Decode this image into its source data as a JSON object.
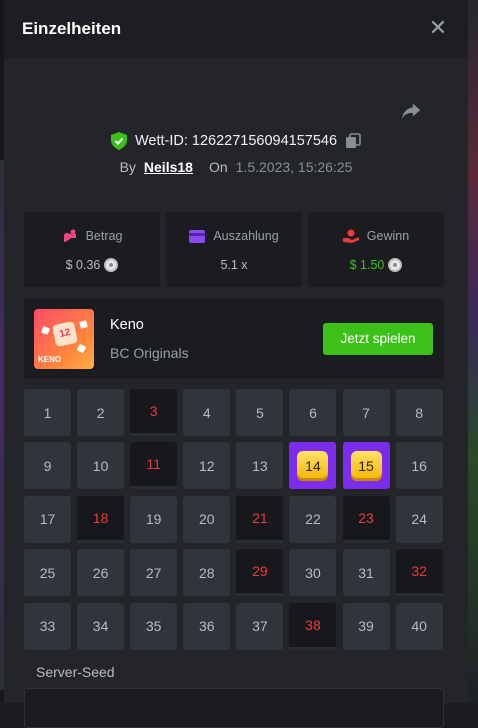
{
  "modal": {
    "title": "Einzelheiten"
  },
  "bet": {
    "id_label": "Wett-ID:",
    "id_value": "126227156094157546",
    "by_label": "By",
    "username": "Neils18",
    "on_label": "On",
    "date": "1.5.2023, 15:26:25"
  },
  "stats": {
    "amount": {
      "label": "Betrag",
      "value": "$ 0.36"
    },
    "payout": {
      "label": "Auszahlung",
      "value": "5.1 x"
    },
    "profit": {
      "label": "Gewinn",
      "value": "$ 1.50"
    }
  },
  "game": {
    "name": "Keno",
    "provider": "BC Originals",
    "play_label": "Jetzt spielen",
    "thumb_label": "KENO",
    "thumb_ball": "12"
  },
  "grid": {
    "numbers": [
      "1",
      "2",
      "3",
      "4",
      "5",
      "6",
      "7",
      "8",
      "9",
      "10",
      "11",
      "12",
      "13",
      "14",
      "15",
      "16",
      "17",
      "18",
      "19",
      "20",
      "21",
      "22",
      "23",
      "24",
      "25",
      "26",
      "27",
      "28",
      "29",
      "30",
      "31",
      "32",
      "33",
      "34",
      "35",
      "36",
      "37",
      "38",
      "39",
      "40"
    ],
    "drawn": [
      3,
      11,
      18,
      21,
      23,
      29,
      32,
      38
    ],
    "hits": [
      14,
      15
    ]
  },
  "server_seed": {
    "label": "Server-Seed"
  },
  "colors": {
    "accent_green": "#3bc117",
    "hit_purple": "#7b2cf0",
    "miss_red": "#ed3b3b",
    "gem_gold": "#f4b400"
  },
  "icons": {
    "close": "close-icon",
    "share": "share-icon",
    "shield": "shield-check-icon",
    "copy": "copy-icon",
    "coin": "coin-icon"
  }
}
